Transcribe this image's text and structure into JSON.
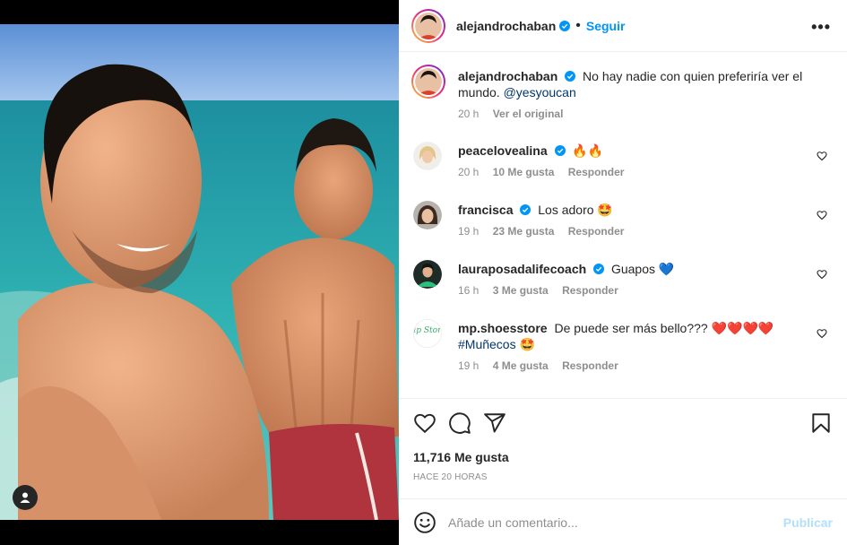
{
  "post": {
    "author": "alejandrochaban",
    "follow_label": "Seguir",
    "more_label": "•••",
    "dot": "•"
  },
  "caption": {
    "username": "alejandrochaban",
    "text": "No hay nadie con quien preferiría ver el mundo.",
    "mention": "@yesyoucan",
    "time": "20 h",
    "see_original": "Ver el original"
  },
  "comments": [
    {
      "username": "peacelovealina",
      "text": "🔥🔥",
      "time": "20 h",
      "likes": "10 Me gusta",
      "reply": "Responder"
    },
    {
      "username": "francisca",
      "text": "Los adoro 🤩",
      "time": "19 h",
      "likes": "23 Me gusta",
      "reply": "Responder"
    },
    {
      "username": "lauraposadalifecoach",
      "text": "Guapos 💙",
      "time": "16 h",
      "likes": "3 Me gusta",
      "reply": "Responder"
    },
    {
      "username": "mp.shoesstore",
      "text": "De puede ser más bello??? ❤️❤️❤️❤️",
      "hashtag": "#Muñecos",
      "hashtag_emoji": "🤩",
      "time": "19 h",
      "likes": "4 Me gusta",
      "reply": "Responder",
      "avatar_text": "vip Store"
    }
  ],
  "actions": {
    "likes": "11,716 Me gusta",
    "time": "HACE 20 HORAS"
  },
  "add_comment": {
    "placeholder": "Añade un comentario...",
    "publish": "Publicar"
  },
  "colors": {
    "accent": "#0095f6",
    "verified": "#0095f6",
    "link": "#00376b",
    "muted": "#8e8e8e"
  },
  "icons": [
    "verified-icon",
    "more-icon",
    "heart-icon",
    "comment-icon",
    "share-icon",
    "bookmark-icon",
    "emoji-icon",
    "user-tag-icon"
  ]
}
